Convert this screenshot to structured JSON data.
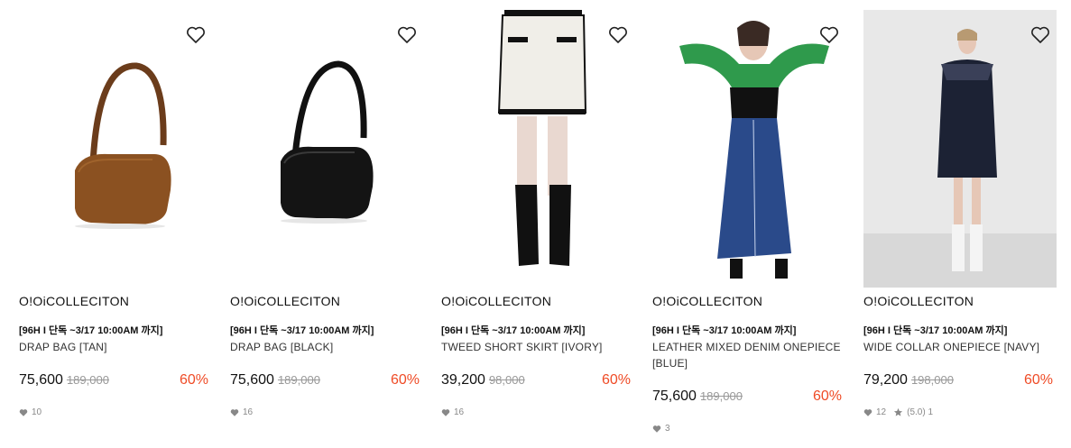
{
  "products": [
    {
      "brand": "O!OiCOLLECITON",
      "tag": "[96H I 단독 ~3/17 10:00AM 까지]",
      "name": "DRAP BAG [TAN]",
      "price": "75,600",
      "original_price": "189,000",
      "discount": "60%",
      "likes": "10"
    },
    {
      "brand": "O!OiCOLLECITON",
      "tag": "[96H I 단독 ~3/17 10:00AM 까지]",
      "name": "DRAP BAG [BLACK]",
      "price": "75,600",
      "original_price": "189,000",
      "discount": "60%",
      "likes": "16"
    },
    {
      "brand": "O!OiCOLLECITON",
      "tag": "[96H I 단독 ~3/17 10:00AM 까지]",
      "name": "TWEED SHORT SKIRT [IVORY]",
      "price": "39,200",
      "original_price": "98,000",
      "discount": "60%",
      "likes": "16"
    },
    {
      "brand": "O!OiCOLLECITON",
      "tag": "[96H I 단독 ~3/17 10:00AM 까지]",
      "name": "LEATHER MIXED DENIM ONEPIECE [BLUE]",
      "price": "75,600",
      "original_price": "189,000",
      "discount": "60%",
      "likes": "3"
    },
    {
      "brand": "O!OiCOLLECITON",
      "tag": "[96H I 단독 ~3/17 10:00AM 까지]",
      "name": "WIDE COLLAR ONEPIECE [NAVY]",
      "price": "79,200",
      "original_price": "198,000",
      "discount": "60%",
      "likes": "12",
      "review": "(5.0) 1"
    }
  ],
  "icons": {
    "wishlist": "heart-outline-icon",
    "likes": "heart-filled-icon",
    "rating": "star-icon"
  },
  "colors": {
    "discount": "#ef4b26",
    "strike": "#999999",
    "meta": "#888888"
  }
}
